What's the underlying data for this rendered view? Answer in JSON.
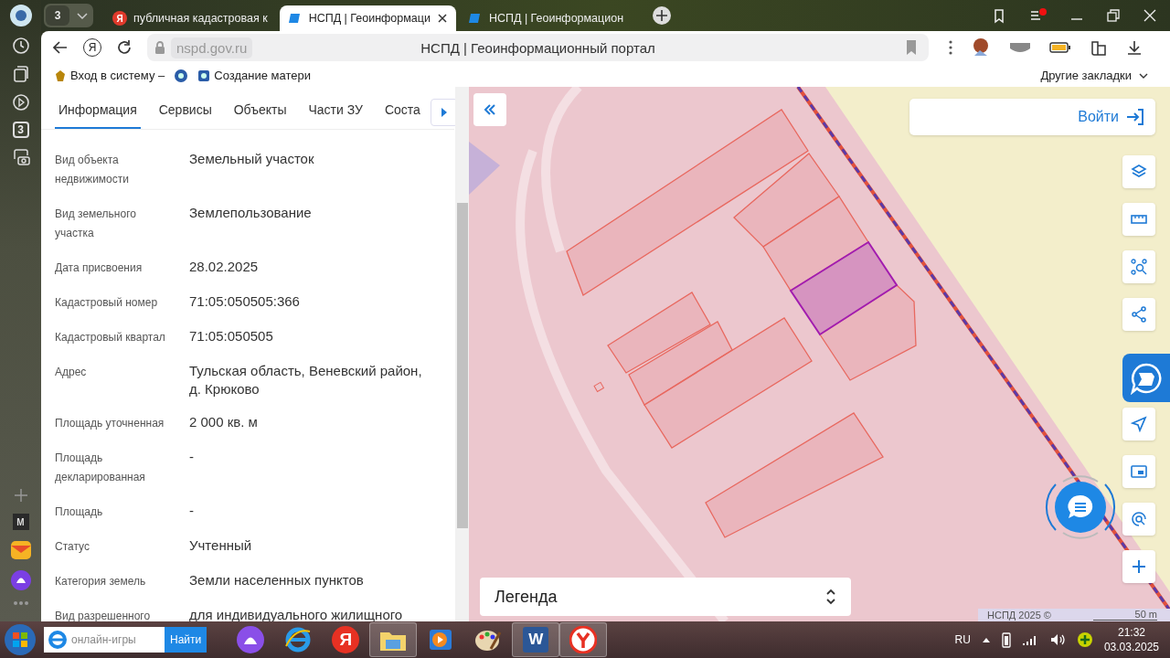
{
  "browser": {
    "sidebar": {
      "tab_counter": "3",
      "mail_letter": "M"
    },
    "tab_group": "3",
    "tabs": [
      {
        "title": "публичная кадастровая к",
        "favicon_letter": "Я",
        "selected": false
      },
      {
        "title": "НСПД | Геоинформаци",
        "selected": true
      },
      {
        "title": "НСПД | Геоинформацион",
        "selected": false
      }
    ],
    "toolbar": {
      "home_letter": "Я",
      "url": "nspd.gov.ru",
      "page_title": "НСПД | Геоинформационный портал"
    },
    "bookmarks": [
      {
        "label": "Вход в систему –"
      },
      {
        "label": "Создание матери"
      }
    ],
    "other_bookmarks": "Другие закладки"
  },
  "panel": {
    "tabs": [
      {
        "label": "Информация",
        "selected": true
      },
      {
        "label": "Сервисы",
        "selected": false
      },
      {
        "label": "Объекты",
        "selected": false
      },
      {
        "label": "Части ЗУ",
        "selected": false
      },
      {
        "label": "Соста",
        "selected": false
      }
    ],
    "rows": [
      {
        "label": "Вид объекта недвижимости",
        "value": "Земельный участок"
      },
      {
        "label": "Вид земельного участка",
        "value": "Землепользование"
      },
      {
        "label": "Дата присвоения",
        "value": "28.02.2025"
      },
      {
        "label": "Кадастровый номер",
        "value": "71:05:050505:366"
      },
      {
        "label": "Кадастровый квартал",
        "value": "71:05:050505"
      },
      {
        "label": "Адрес",
        "value": "Тульская область, Веневский район, д. Крюково"
      },
      {
        "label": "Площадь уточненная",
        "value": "2 000 кв. м"
      },
      {
        "label": "Площадь декларированная",
        "value": "-"
      },
      {
        "label": "Площадь",
        "value": "-"
      },
      {
        "label": "Статус",
        "value": "Учтенный"
      },
      {
        "label": "Категория земель",
        "value": "Земли населенных пунктов"
      },
      {
        "label": "Вид разрешенного",
        "value": "для индивидуального жилищного"
      }
    ]
  },
  "map": {
    "login": "Войти",
    "legend": "Легенда",
    "attribution": "НСПД 2025 ©",
    "scale": "50 m"
  },
  "taskbar": {
    "search_placeholder": "онлайн-игры",
    "search_button": "Найти",
    "yandex_letter": "Я",
    "word_letter": "W",
    "language": "RU",
    "time": "21:32",
    "date": "03.03.2025"
  }
}
